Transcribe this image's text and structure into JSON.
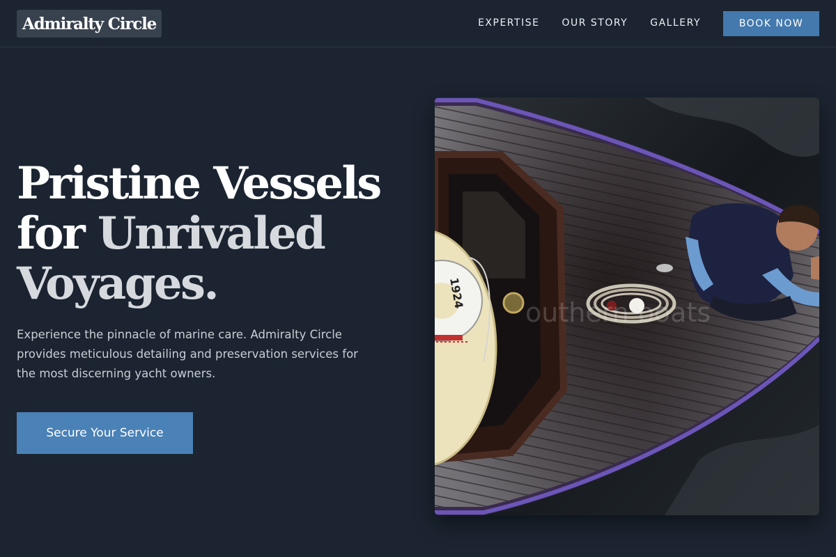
{
  "header": {
    "logo_text": "Admiralty Circle",
    "nav": [
      {
        "label": "EXPERTISE"
      },
      {
        "label": "OUR STORY"
      },
      {
        "label": "GALLERY"
      }
    ],
    "book_button_label": "BOOK NOW"
  },
  "hero": {
    "title_line_1": "Pristine Vessels",
    "title_line_2_start": "for ",
    "title_line_2_accent": "Unrivaled",
    "title_line_3": "Voyages.",
    "description": "Experience the pinnacle of marine care. Admiralty Circle provides meticulous detailing and preservation services for the most discerning yacht owners.",
    "cta_label": "Secure Your Service"
  },
  "image": {
    "lifebuoy_text": "1924",
    "watermark": "outhern boats"
  },
  "colors": {
    "background": "#1b2430",
    "accent_button": "#4a81b6",
    "nav_button": "#4379ad",
    "title_accent": "#d6d9de"
  }
}
